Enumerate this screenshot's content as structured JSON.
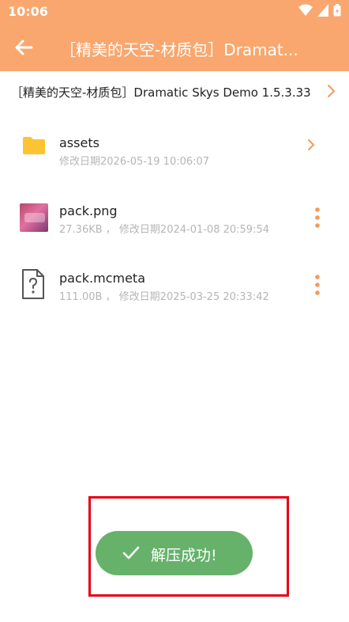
{
  "status": {
    "time": "10:06"
  },
  "appbar": {
    "title": "［精美的天空-材质包］Dramat..."
  },
  "path": {
    "text": "［精美的天空-材质包］Dramatic Skys Demo 1.5.3.33"
  },
  "files": [
    {
      "name": "assets",
      "meta": "修改日期2026-05-19 10:06:07",
      "type": "folder"
    },
    {
      "name": "pack.png",
      "meta": "27.36KB ， 修改日期2024-01-08 20:59:54",
      "type": "image"
    },
    {
      "name": "pack.mcmeta",
      "meta": "111.00B ， 修改日期2025-03-25 20:33:42",
      "type": "unknown"
    }
  ],
  "toast": {
    "text": "解压成功!"
  },
  "colors": {
    "accent": "#f9a76e",
    "toast": "#66b26b",
    "highlight": "#e60012",
    "meta": "#b6b6b6"
  },
  "icons": {
    "back": "arrow-left-icon",
    "path": "chevron-right-icon",
    "folder": "folder-icon",
    "unknown_file": "unknown-file-icon",
    "more": "more-vert-icon",
    "check": "check-icon"
  }
}
